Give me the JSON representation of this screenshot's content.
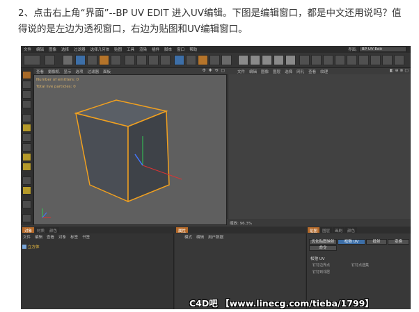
{
  "caption": {
    "line1": "2、点击右上角“界面”--BP UV EDIT 进入UV编辑。下图是编辑窗口，都是中文还用说吗？值",
    "line2": "得说的是左边为透视窗口，右边为贴图和UV编辑窗口。"
  },
  "app": {
    "menu": [
      "文件",
      "编辑",
      "图像",
      "选择",
      "过滤器",
      "选择几何体",
      "贴图",
      "工具",
      "渲染",
      "插件",
      "脚本",
      "窗口",
      "帮助"
    ],
    "layout_label": "界面:",
    "layout_value": "BP UV Edit"
  },
  "viewport": {
    "menu": [
      "查看",
      "摄像机",
      "显示",
      "选项",
      "过滤器",
      "面板"
    ],
    "nav_icons": "✣ ✚ ⟲ ▢",
    "info": {
      "emitters": "Number of emitters: 0",
      "particles": "Total live particles: 0"
    }
  },
  "uv_editor": {
    "menu": [
      "文件",
      "编辑",
      "图像",
      "图层",
      "选择",
      "网孔",
      "查看",
      "纹理"
    ],
    "icons": "◧ ⊕ ⊗ ▢",
    "zoom": "缩放: 96.3%"
  },
  "objects_panel": {
    "tabs": [
      "对象",
      "材质",
      "颜色"
    ],
    "menu": [
      "文件",
      "编辑",
      "查看",
      "对象",
      "标签",
      "书签"
    ],
    "object_name": "立方体"
  },
  "attributes_panel": {
    "tabs": [
      "属性"
    ],
    "menu": [
      "模式",
      "编辑",
      "用户数据"
    ]
  },
  "uv_panel": {
    "tabs": [
      "贴图",
      "图层",
      "画刷",
      "颜色"
    ],
    "buttons": [
      "优化贴图映射",
      "松弛 UV",
      "投射",
      "变换"
    ],
    "command": "命令",
    "section": "松弛 UV",
    "options": [
      "钉钉边界点",
      "钉钉到邻居",
      "钉钉点选集"
    ]
  },
  "watermark": "C4D吧 【www.linecg.com/tieba/1799】"
}
